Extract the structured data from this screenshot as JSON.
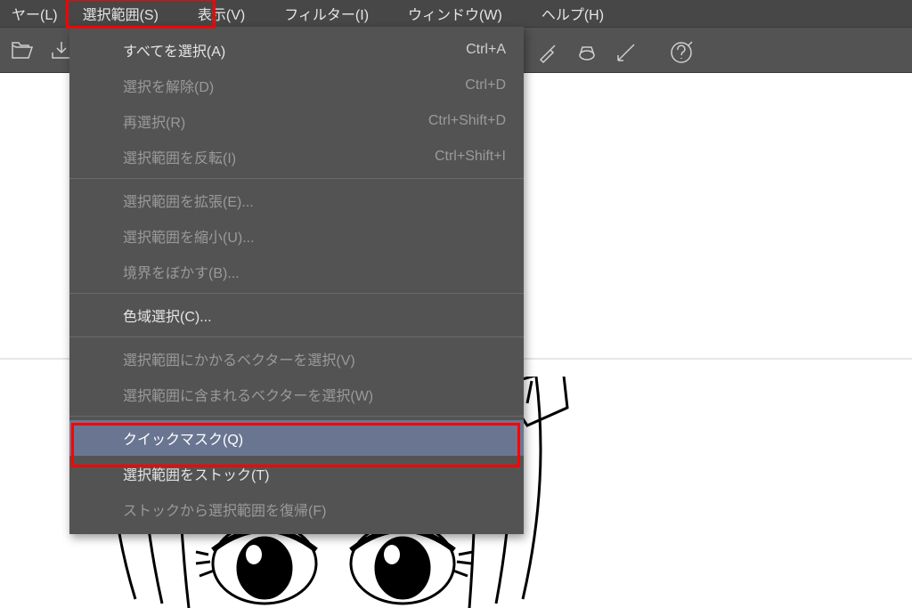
{
  "menubar": {
    "partial_left": "ヤー(L)",
    "items": [
      {
        "label": "選択範囲(S)",
        "active": true,
        "name": "menu-select"
      },
      {
        "label": "表示(V)",
        "name": "menu-view"
      },
      {
        "label": "フィルター(I)",
        "name": "menu-filter"
      },
      {
        "label": "ウィンドウ(W)",
        "name": "menu-window"
      },
      {
        "label": "ヘルプ(H)",
        "name": "menu-help"
      }
    ]
  },
  "dropdown": {
    "groups": [
      [
        {
          "label": "すべてを選択(A)",
          "shortcut": "Ctrl+A",
          "enabled": true,
          "name": "dd-select-all"
        },
        {
          "label": "選択を解除(D)",
          "shortcut": "Ctrl+D",
          "enabled": false,
          "name": "dd-deselect"
        },
        {
          "label": "再選択(R)",
          "shortcut": "Ctrl+Shift+D",
          "enabled": false,
          "name": "dd-reselect"
        },
        {
          "label": "選択範囲を反転(I)",
          "shortcut": "Ctrl+Shift+I",
          "enabled": false,
          "name": "dd-invert"
        }
      ],
      [
        {
          "label": "選択範囲を拡張(E)...",
          "enabled": false,
          "name": "dd-expand"
        },
        {
          "label": "選択範囲を縮小(U)...",
          "enabled": false,
          "name": "dd-contract"
        },
        {
          "label": "境界をぼかす(B)...",
          "enabled": false,
          "name": "dd-feather"
        }
      ],
      [
        {
          "label": "色域選択(C)...",
          "enabled": true,
          "name": "dd-color-range"
        }
      ],
      [
        {
          "label": "選択範囲にかかるベクターを選択(V)",
          "enabled": false,
          "name": "dd-vector-touching"
        },
        {
          "label": "選択範囲に含まれるベクターを選択(W)",
          "enabled": false,
          "name": "dd-vector-contained"
        }
      ],
      [
        {
          "label": "クイックマスク(Q)",
          "enabled": true,
          "hover": true,
          "name": "dd-quick-mask"
        },
        {
          "label": "選択範囲をストック(T)",
          "enabled": true,
          "name": "dd-stock"
        },
        {
          "label": "ストックから選択範囲を復帰(F)",
          "enabled": false,
          "name": "dd-restore-stock"
        }
      ]
    ]
  },
  "toolbar_icons": [
    "open-icon",
    "save-icon"
  ],
  "toolbar_icons_right": [
    "brush-icon",
    "bucket-icon",
    "line-icon",
    "help-icon"
  ]
}
